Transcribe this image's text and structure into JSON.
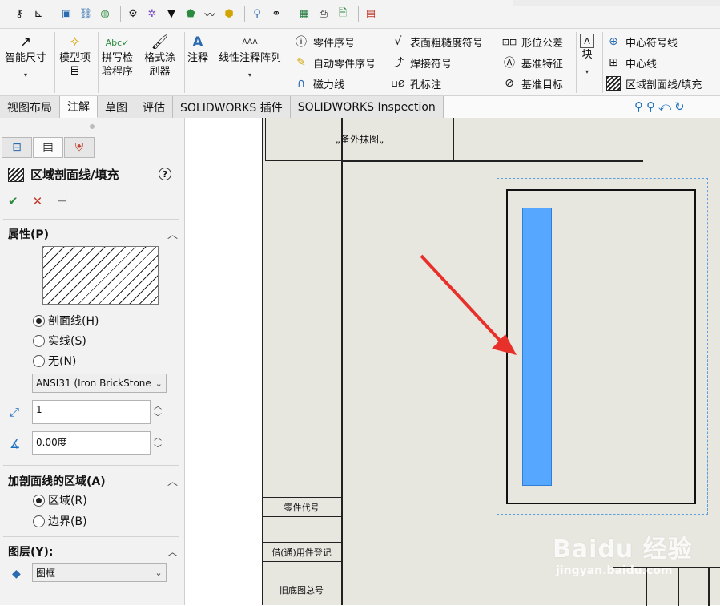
{
  "ribbon": {
    "smart_dimension": "智能尺寸",
    "model_items": "模型项\n目",
    "spell_check": "拼写检\n验程序",
    "format_painter": "格式涂\n刷器",
    "note": "注释",
    "linear_note_pattern": "线性注释阵列",
    "balloon": "零件序号",
    "auto_balloon": "自动零件序号",
    "magnetic_line": "磁力线",
    "surface_finish": "表面粗糙度符号",
    "weld_symbol": "焊接符号",
    "hole_callout": "孔标注",
    "geometric_tolerance": "形位公差",
    "datum_feature": "基准特征",
    "datum_target": "基准目标",
    "block": "块",
    "center_mark": "中心符号线",
    "centerline": "中心线",
    "area_hatch": "区域剖面线/填充"
  },
  "tabs": [
    {
      "label": "视图布局",
      "active": false
    },
    {
      "label": "注解",
      "active": true
    },
    {
      "label": "草图",
      "active": false
    },
    {
      "label": "评估",
      "active": false
    },
    {
      "label": "SOLIDWORKS 插件",
      "active": false
    },
    {
      "label": "SOLIDWORKS Inspection",
      "active": false
    }
  ],
  "panel": {
    "title": "区域剖面线/填充",
    "help": "?",
    "properties_title": "属性(P)",
    "radio_hatch": "剖面线(H)",
    "radio_solid": "实线(S)",
    "radio_none": "无(N)",
    "pattern_value": "ANSI31 (Iron BrickStone)",
    "scale_value": "1",
    "angle_value": "0.00度",
    "area_section_title": "加剖面线的区域(A)",
    "radio_region": "区域(R)",
    "radio_boundary": "边界(B)",
    "layer_title": "图层(Y):",
    "layer_value": "图框"
  },
  "drawing": {
    "title_text": "„备外抹图„",
    "cell_part_code": "零件代号",
    "cell_borrow": "借(通)用件登记",
    "cell_old_drawing": "旧底图总号"
  },
  "watermark": {
    "brand": "Baidu 经验",
    "url": "jingyan.baidu.com"
  },
  "colors": {
    "selection_fill": "#55a7ff",
    "arrow": "#e8302a",
    "sheet_bg": "#e7e6df"
  }
}
